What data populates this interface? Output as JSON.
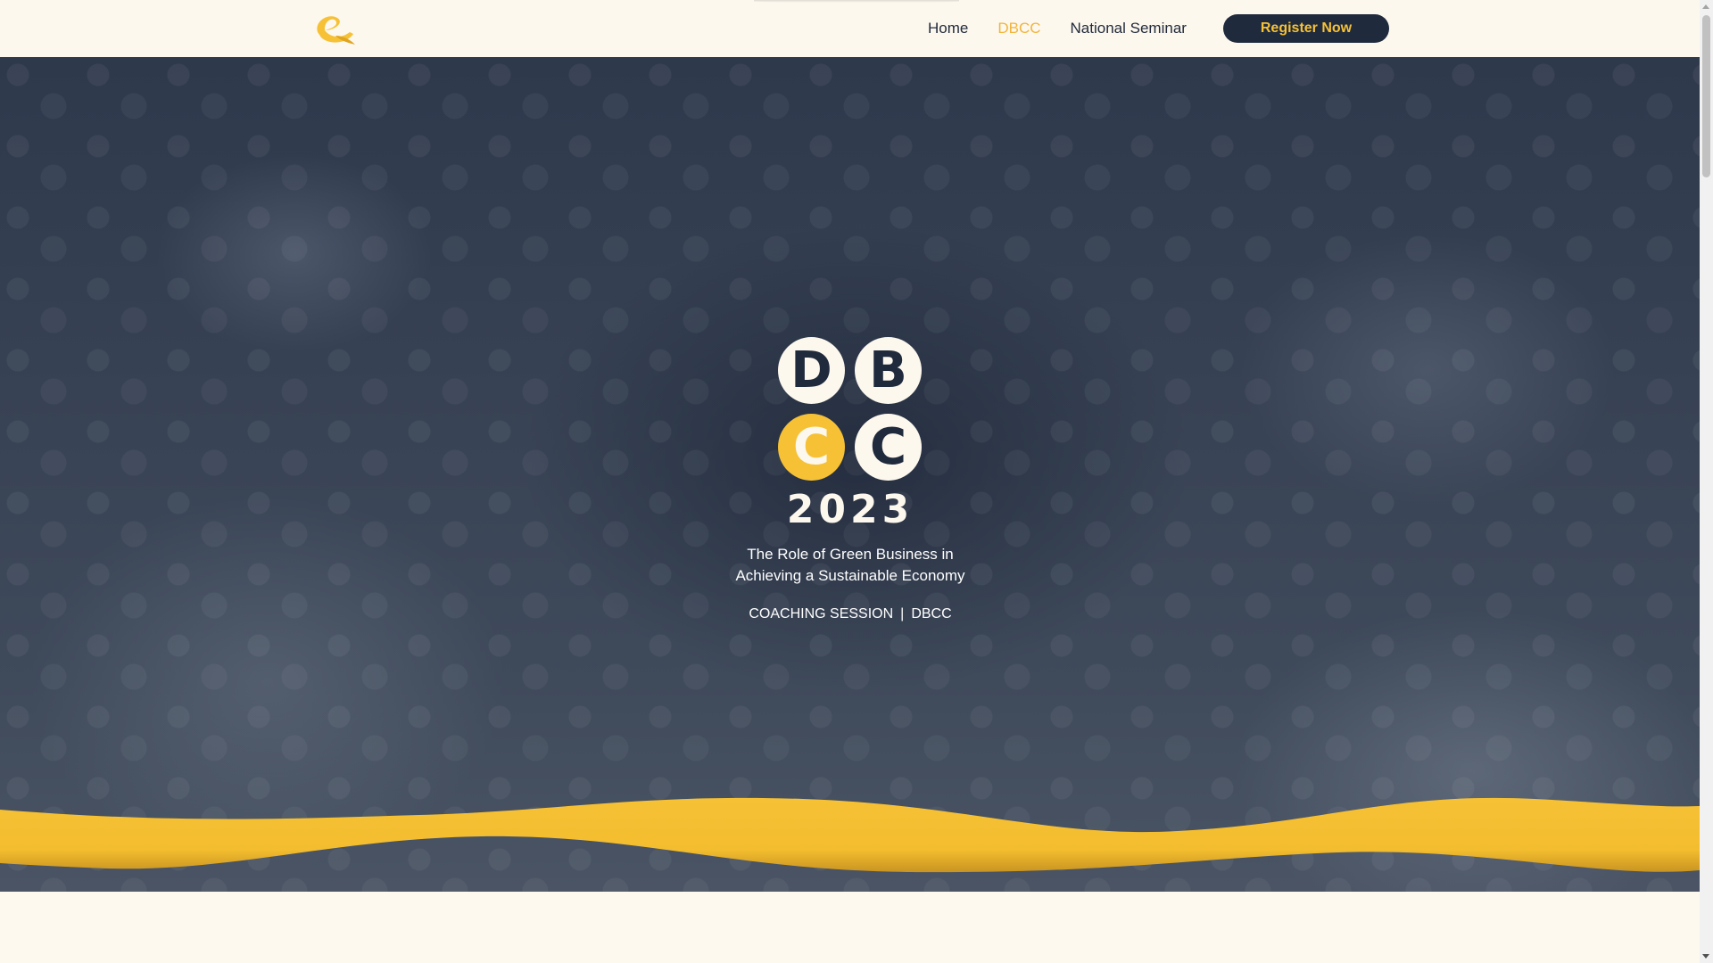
{
  "navbar": {
    "logo_icon": "e-brand-logo-icon",
    "links": [
      {
        "label": "Home",
        "active": false
      },
      {
        "label": "DBCC",
        "active": true
      },
      {
        "label": "National Seminar",
        "active": false
      }
    ],
    "register_label": "Register Now"
  },
  "hero": {
    "logo_letters": [
      "D",
      "B",
      "C",
      "C"
    ],
    "year": "2023",
    "tagline_line1": "The Role of Green Business in",
    "tagline_line2": "Achieving a Sustainable Economy",
    "session_left": "COACHING SESSION",
    "session_sep": "|",
    "session_right": "DBCC"
  },
  "colors": {
    "accent": "#f6c135",
    "navy": "#1f2a3d",
    "cream": "#fdf8ee",
    "active_link": "#f2b43a"
  }
}
